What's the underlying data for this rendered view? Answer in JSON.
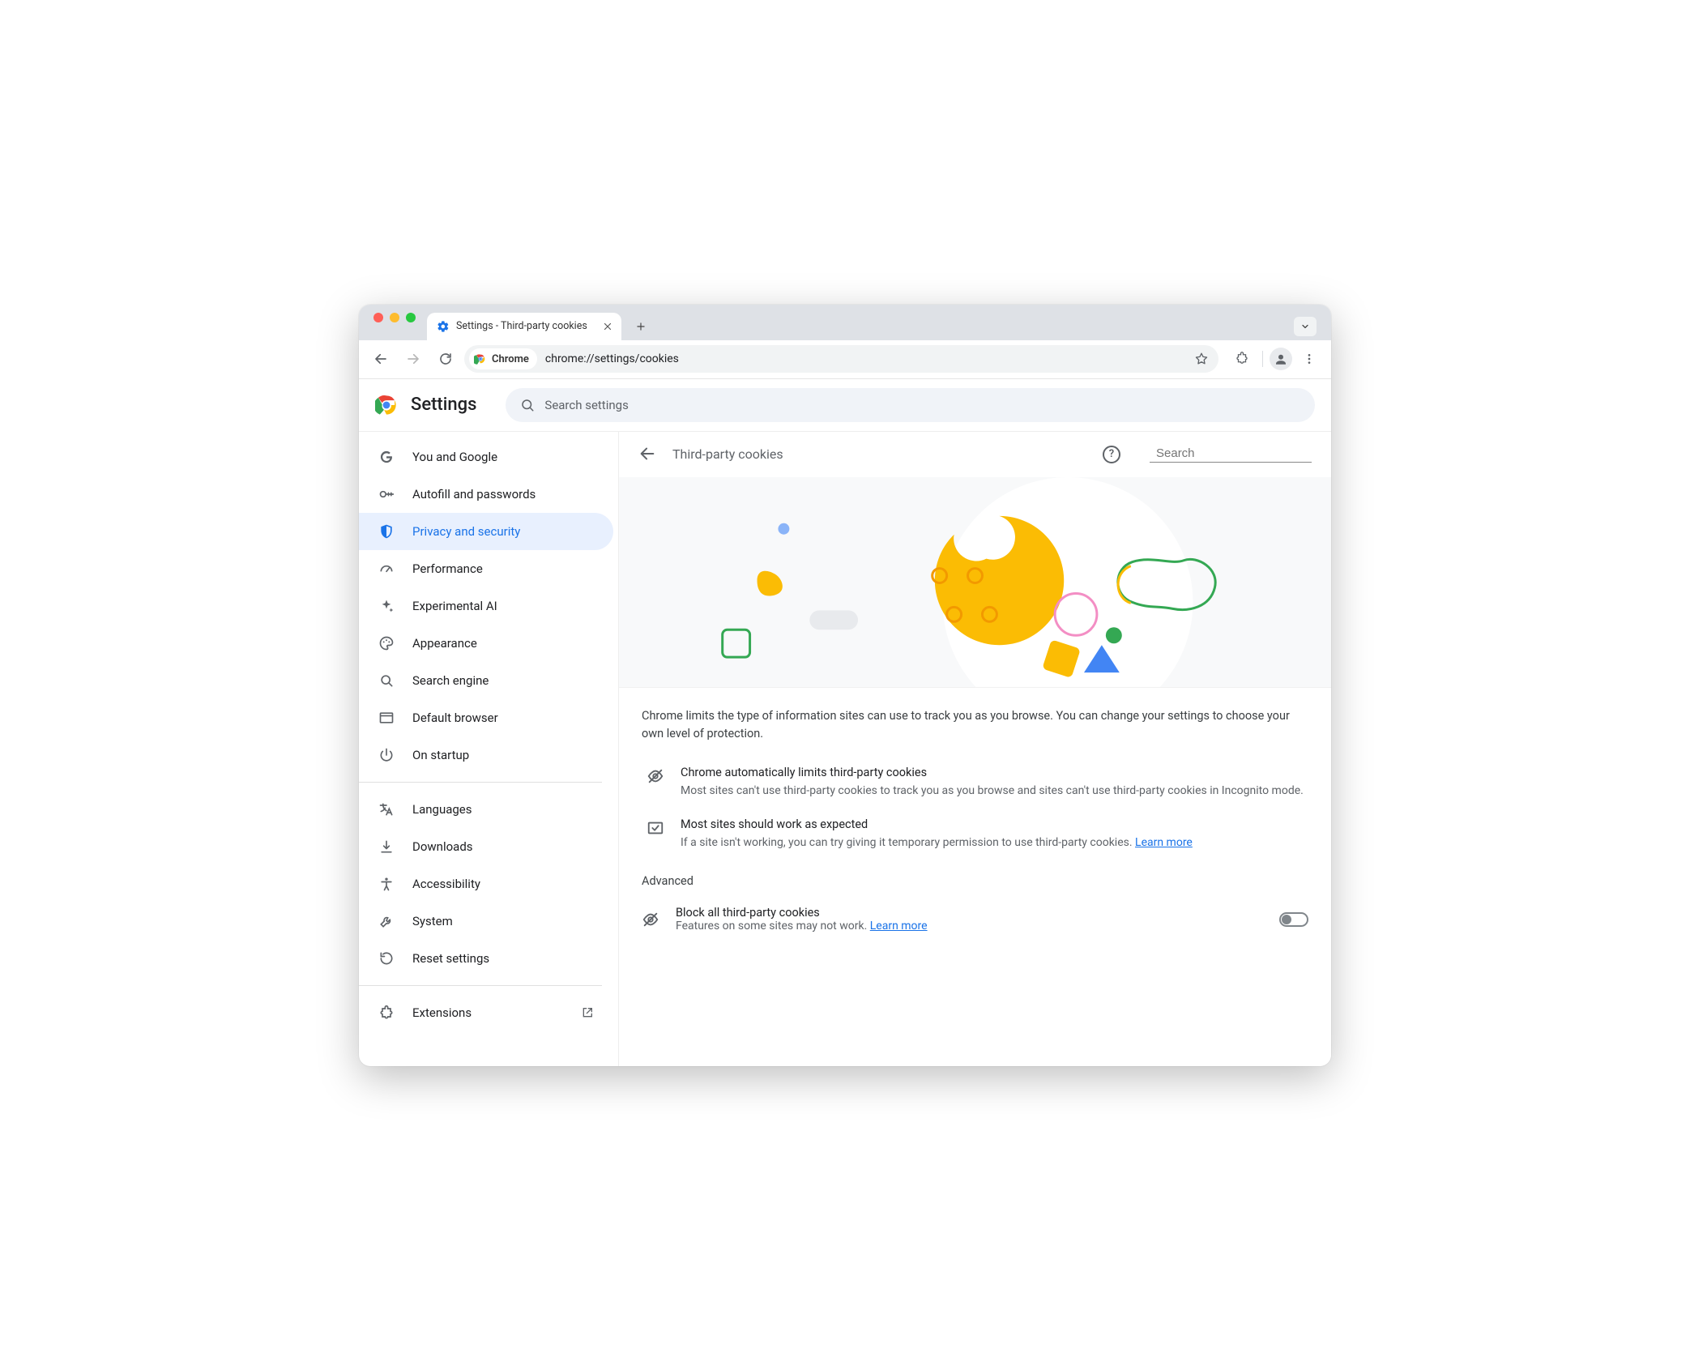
{
  "window": {
    "tab_title": "Settings - Third-party cookies"
  },
  "toolbar": {
    "site_chip": "Chrome",
    "url": "chrome://settings/cookies"
  },
  "settings": {
    "title": "Settings",
    "search_placeholder": "Search settings"
  },
  "sidebar": {
    "items": [
      {
        "label": "You and Google"
      },
      {
        "label": "Autofill and passwords"
      },
      {
        "label": "Privacy and security"
      },
      {
        "label": "Performance"
      },
      {
        "label": "Experimental AI"
      },
      {
        "label": "Appearance"
      },
      {
        "label": "Search engine"
      },
      {
        "label": "Default browser"
      },
      {
        "label": "On startup"
      }
    ],
    "items2": [
      {
        "label": "Languages"
      },
      {
        "label": "Downloads"
      },
      {
        "label": "Accessibility"
      },
      {
        "label": "System"
      },
      {
        "label": "Reset settings"
      }
    ],
    "extensions": "Extensions"
  },
  "main": {
    "title": "Third-party cookies",
    "search_label": "Search",
    "intro": "Chrome limits the type of information sites can use to track you as you browse. You can change your settings to choose your own level of protection.",
    "row1": {
      "title": "Chrome automatically limits third-party cookies",
      "desc": "Most sites can't use third-party cookies to track you as you browse and sites can't use third-party cookies in Incognito mode."
    },
    "row2": {
      "title": "Most sites should work as expected",
      "desc": "If a site isn't working, you can try giving it temporary permission to use third-party cookies. ",
      "link": "Learn more"
    },
    "advanced": "Advanced",
    "block": {
      "title": "Block all third-party cookies",
      "desc": "Features on some sites may not work. ",
      "link": "Learn more"
    }
  }
}
